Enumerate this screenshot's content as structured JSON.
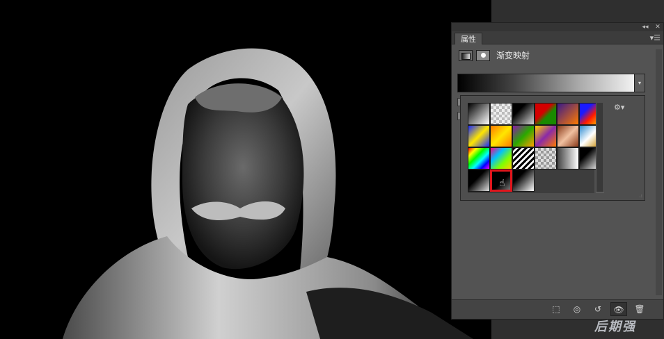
{
  "panel": {
    "tab_label": "属性",
    "collapse_glyph": "◂◂",
    "close_glyph": "✕",
    "menu_glyph": "▾☰",
    "title": "渐变映射",
    "dropdown_glyph": "▾",
    "gear_glyph": "⚙▾",
    "grip_glyph": ".:"
  },
  "swatches": [
    {
      "name": "black-white",
      "bg": "linear-gradient(135deg,#000,#fff)"
    },
    {
      "name": "checker-transparent",
      "bg": "repeating-conic-gradient(#bbb 0% 25%, #eee 0% 50%) 0 0/8px 8px"
    },
    {
      "name": "black-transparent",
      "bg": "linear-gradient(135deg,#000 30%,#d8d8d8)"
    },
    {
      "name": "red-green",
      "bg": "linear-gradient(135deg,#d40000 40%,#1a8a00 60%)"
    },
    {
      "name": "violet-orange",
      "bg": "linear-gradient(135deg,#3a1a8a,#ff7a00)"
    },
    {
      "name": "blue-red-yellow",
      "bg": "linear-gradient(135deg,#1a1aff 30%,#ff1a00 60%,#ffd000)"
    },
    {
      "name": "blue-yellow-blue",
      "bg": "linear-gradient(135deg,#1a2aff,#ffe600,#1a2aff)"
    },
    {
      "name": "orange-yellow-orange",
      "bg": "linear-gradient(135deg,#ff7a00,#ffe600,#ff7a00)"
    },
    {
      "name": "violet-green-orange",
      "bg": "linear-gradient(135deg,#8a1aa8,#2aa800,#ffa000)"
    },
    {
      "name": "yellow-violet-orange",
      "bg": "linear-gradient(135deg,#ffd200,#8a2aa8,#ff7a00)"
    },
    {
      "name": "copper",
      "bg": "linear-gradient(135deg,#8a3a1a,#f0c0a0,#8a3a1a)"
    },
    {
      "name": "chrome",
      "bg": "linear-gradient(135deg,#2a8ad0,#fff 50%,#c88a00)"
    },
    {
      "name": "spectrum",
      "bg": "linear-gradient(135deg,#ff0000,#ffff00,#00ff00,#00ffff,#0000ff,#ff00ff)"
    },
    {
      "name": "transparent-rainbow",
      "bg": "linear-gradient(135deg,#ff0080,#00c0ff,#80ff00,#ffd000)"
    },
    {
      "name": "transparent-stripes",
      "bg": "repeating-linear-gradient(135deg,#000 0 3px,#fff 3px 6px)"
    },
    {
      "name": "checker-gray",
      "bg": "repeating-conic-gradient(#999 0% 25%, #ddd 0% 50%) 0 0/8px 8px"
    },
    {
      "name": "gray-white",
      "bg": "linear-gradient(90deg,#444,#fff)"
    },
    {
      "name": "black-white-2",
      "bg": "linear-gradient(135deg,#000 30%,#fff)"
    },
    {
      "name": "black-gray",
      "bg": "linear-gradient(135deg,#000 40%,#e0e0e0)"
    },
    {
      "name": "black-selected",
      "bg": "linear-gradient(135deg,#000 55%,#777)",
      "selected": true
    },
    {
      "name": "white-black",
      "bg": "linear-gradient(135deg,#000 30%,#fff)"
    }
  ],
  "toolbar": {
    "clip_glyph": "⬚",
    "view_glyph": "◎",
    "reset_glyph": "↺",
    "visibility_glyph": "👁",
    "delete_glyph": "🗑"
  },
  "watermark": "后期强"
}
